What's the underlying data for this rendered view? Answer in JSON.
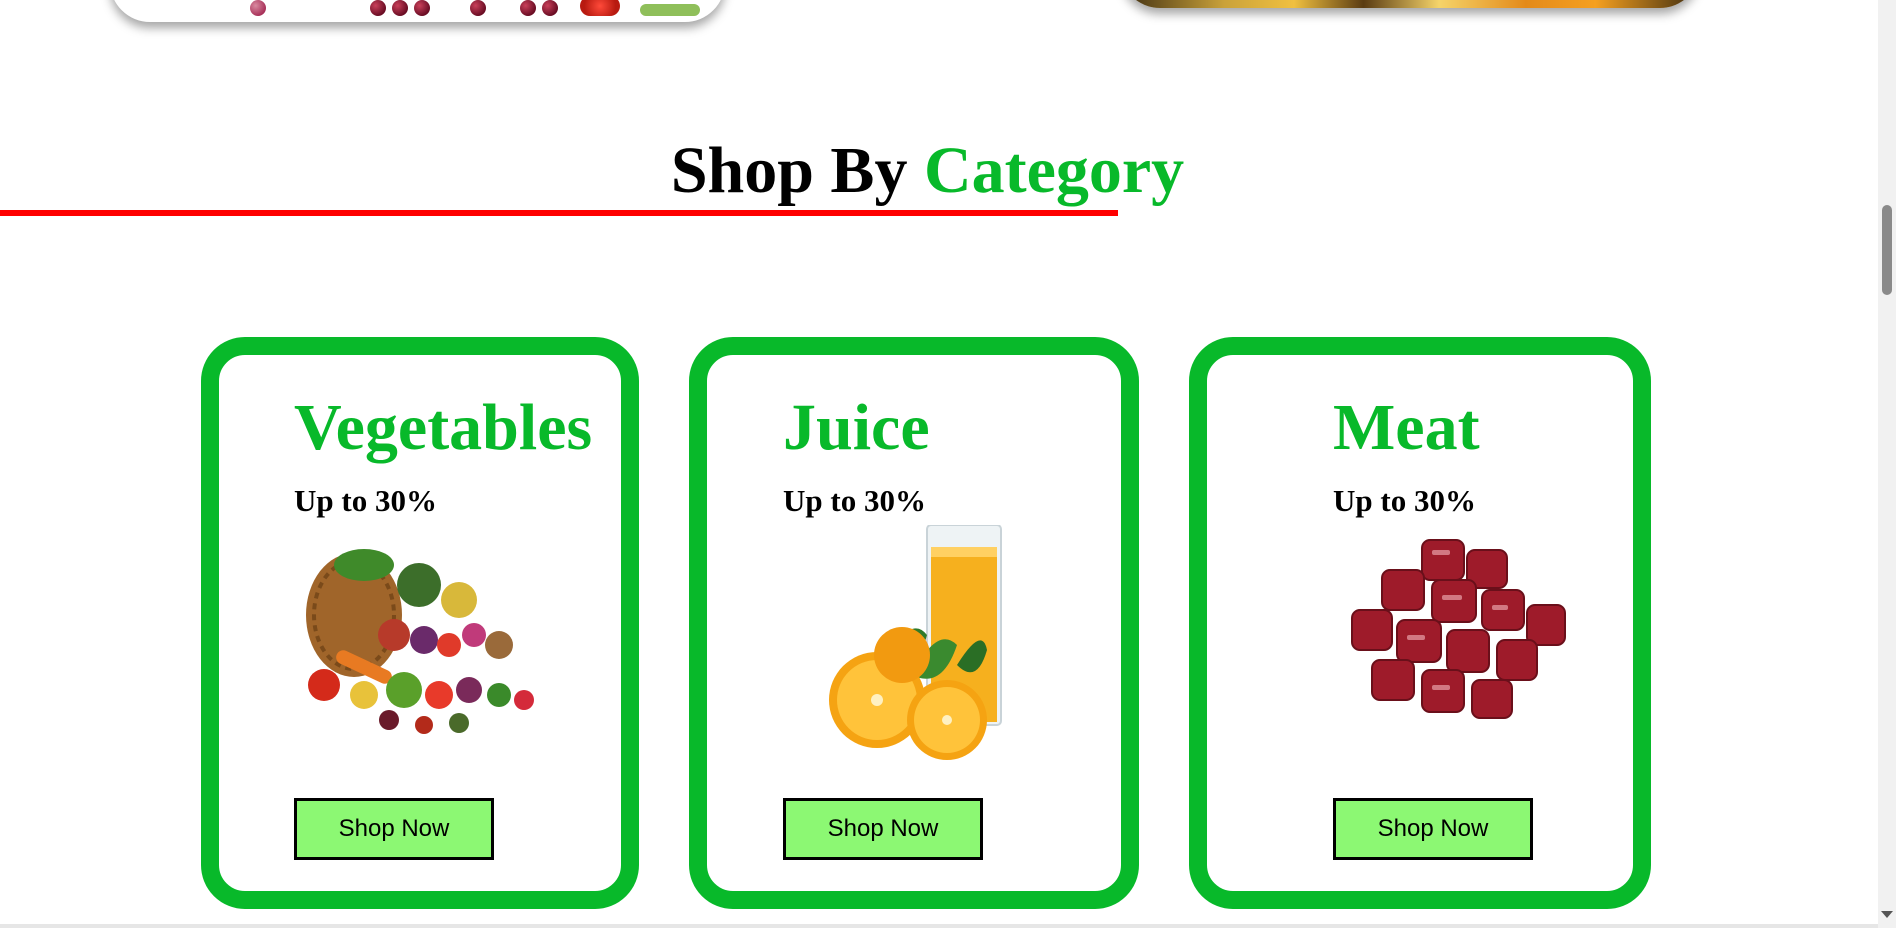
{
  "section": {
    "title_main": "Shop By",
    "title_accent": "Category"
  },
  "colors": {
    "accent_green": "#08b92a",
    "underline_red": "#ff0000",
    "button_green": "#8cf873"
  },
  "categories": [
    {
      "name": "Vegetables",
      "discount": "Up to 30%",
      "button": "Shop Now",
      "image": "vegetable-basket-image"
    },
    {
      "name": "Juice",
      "discount": "Up to 30%",
      "button": "Shop Now",
      "image": "orange-juice-image"
    },
    {
      "name": "Meat",
      "discount": "Up to 30%",
      "button": "Shop Now",
      "image": "raw-meat-image"
    }
  ]
}
